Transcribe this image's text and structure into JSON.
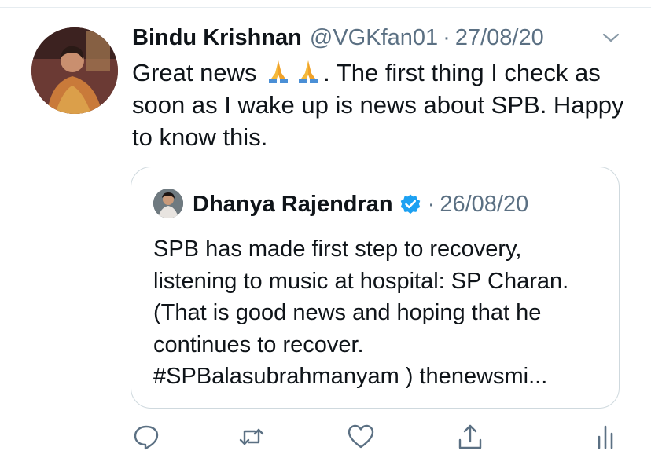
{
  "tweet": {
    "author_name": "Bindu Krishnan",
    "handle": "@VGKfan01",
    "separator": "·",
    "date": "27/08/20",
    "text_before_emoji": "Great news ",
    "emoji": "folded-hands",
    "text_after_emoji": ". The first thing I check as soon as I wake up is news about SPB. Happy to know this."
  },
  "quoted": {
    "author_name": "Dhanya Rajendran",
    "separator": "·",
    "date": "26/08/20",
    "text": "SPB has made first step to recovery, listening to music at hospital: SP Charan. (That is good news and hoping that he continues to recover. #SPBalasubrahmanyam ) thenewsmi..."
  },
  "actions": [
    {
      "icon": "reply-icon"
    },
    {
      "icon": "retweet-icon"
    },
    {
      "icon": "like-icon"
    },
    {
      "icon": "share-icon"
    },
    {
      "icon": "analytics-icon"
    }
  ],
  "colors": {
    "text": "#0f1419",
    "secondary": "#5b7083",
    "accent": "#1da1f2",
    "border": "#cfd9de"
  }
}
